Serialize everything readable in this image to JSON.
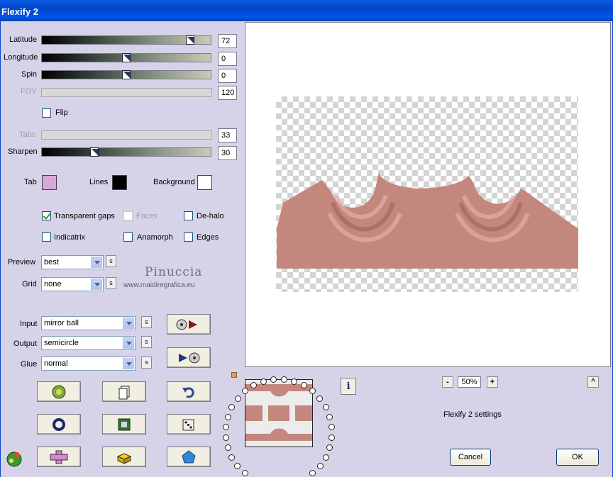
{
  "window": {
    "title": "Flexify 2"
  },
  "sliders": [
    {
      "key": "latitude",
      "label": "Latitude",
      "value": "72",
      "fraction": 0.9,
      "enabled": true
    },
    {
      "key": "longitude",
      "label": "Longitude",
      "value": "0",
      "fraction": 0.5,
      "enabled": true
    },
    {
      "key": "spin",
      "label": "Spin",
      "value": "0",
      "fraction": 0.5,
      "enabled": true
    },
    {
      "key": "fov",
      "label": "FOV",
      "value": "120",
      "enabled": false
    },
    {
      "key": "tabs",
      "label": "Tabs",
      "value": "33",
      "enabled": false
    },
    {
      "key": "sharpen",
      "label": "Sharpen",
      "value": "30",
      "fraction": 0.3,
      "enabled": true
    }
  ],
  "flip": {
    "label": "Flip",
    "checked": false
  },
  "colors": {
    "tab": {
      "label": "Tab",
      "value": "#d8a8d8"
    },
    "lines": {
      "label": "Lines",
      "value": "#000000"
    },
    "background": {
      "label": "Background",
      "value": "#ffffff"
    }
  },
  "options": {
    "transparent_gaps": {
      "label": "Transparent gaps",
      "checked": true
    },
    "faces": {
      "label": "Faces",
      "checked": false,
      "enabled": false
    },
    "de_halo": {
      "label": "De-halo",
      "checked": false
    },
    "indicatrix": {
      "label": "Indicatrix",
      "checked": false
    },
    "anamorph": {
      "label": "Anamorph",
      "checked": false
    },
    "edges": {
      "label": "Edges",
      "checked": false
    }
  },
  "preview_mode": {
    "label": "Preview",
    "value": "best"
  },
  "grid": {
    "label": "Grid",
    "value": "none"
  },
  "input": {
    "label": "Input",
    "value": "mirror ball"
  },
  "output": {
    "label": "Output",
    "value": "semicircle"
  },
  "glue": {
    "label": "Glue",
    "value": "normal"
  },
  "small_button_label": "s",
  "watermark": {
    "line1": "Pinuccia",
    "line2": "www.maidiregrafica.eu"
  },
  "zoom": {
    "value": "50%",
    "minus": "-",
    "plus": "+"
  },
  "up_label": "^",
  "info_label": "i",
  "settings_label": "Flexify 2 settings",
  "buttons": {
    "cancel": "Cancel",
    "ok": "OK"
  },
  "accent_colors": {
    "shape": "#c4877d",
    "shape_dark": "#a0685e",
    "shape_light": "#e2b0aa"
  }
}
